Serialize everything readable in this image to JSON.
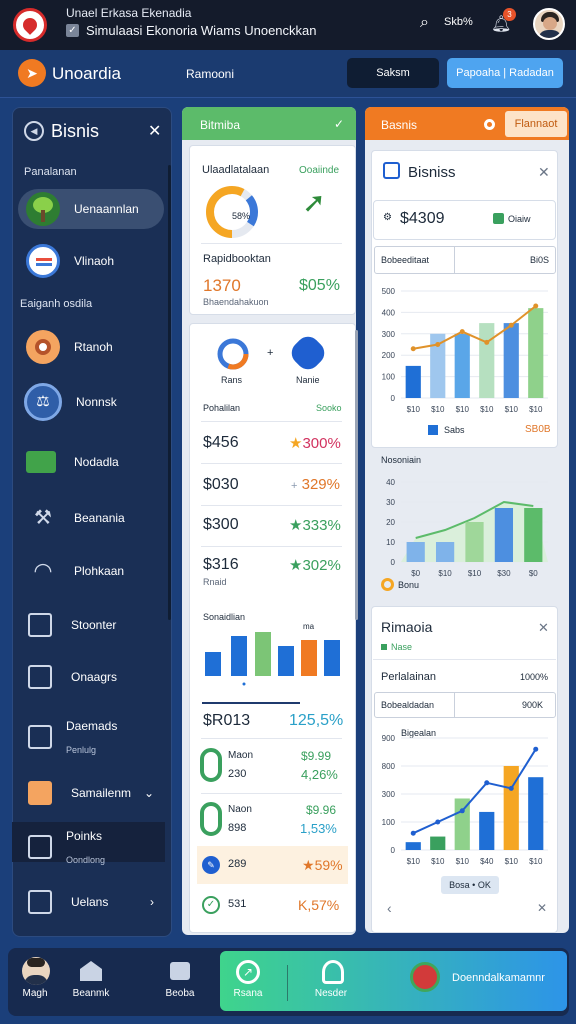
{
  "topbar": {
    "line1": "Unael Erkasa Ekenadia",
    "line2": "Simulaasi Ekonoria Wiams Unoenckkan",
    "search_label": "Skb%",
    "notif_count": "3"
  },
  "nav": {
    "app_name": "Unoardia",
    "middle": "Ramooni",
    "btn_dark": "Saksm",
    "btn_blue": "Papoaha | Radadan"
  },
  "sidebar": {
    "title": "Bisnis",
    "section1": "Panalanan",
    "section2": "Eaiganh osdila",
    "items": [
      {
        "label": "Uenaannlan"
      },
      {
        "label": "Vlinaoh"
      },
      {
        "label": "Rtanoh"
      },
      {
        "label": "Nonnsk"
      },
      {
        "label": "Nodadla"
      },
      {
        "label": "Beanania"
      },
      {
        "label": "Plohkaan"
      },
      {
        "label": "Stoonter"
      },
      {
        "label": "Onaagrs"
      },
      {
        "label": "Daemads",
        "sub": "Penlulg"
      },
      {
        "label": "Samailenm"
      },
      {
        "label": "Poinks",
        "sub": "Oondlong"
      },
      {
        "label": "Uelans"
      }
    ]
  },
  "col1": {
    "header": "Bitmiba",
    "card1": {
      "title": "Ulaadlatalaan",
      "pct_label": "Ooaiinde",
      "donut_label": "58%",
      "row_label": "Rapidbooktan",
      "value": "1370",
      "value_sub": "Bhaendahakuon",
      "pct": "$05%"
    },
    "card2": {
      "icon1_label": "Rans",
      "icon2_label": "Nanie",
      "table_label": "Pohalilan",
      "table_pct_label": "Sooko",
      "rows": [
        {
          "value": "$456",
          "pct": "300%",
          "color": "#d2325f"
        },
        {
          "value": "$030",
          "pct": "329%",
          "color": "#e0772a"
        },
        {
          "value": "$300",
          "pct": "333%",
          "color": "#3aa05e"
        },
        {
          "value": "$316",
          "pct": "302%",
          "color": "#3aa05e",
          "sub": "Rnaid"
        }
      ],
      "chart_label": "Sonaidlian",
      "chart_mark": "ma",
      "summary_value": "$R013",
      "summary_pct": "125,5%",
      "list": [
        {
          "title": "Maon",
          "value": "230",
          "chg1": "$9.99",
          "chg2": "4,26%"
        },
        {
          "title": "Naon",
          "value": "898",
          "chg1": "$9.96",
          "chg2": "1,53%"
        },
        {
          "value": "289",
          "chg": "59%"
        },
        {
          "value": "531",
          "chg": "57%"
        }
      ]
    }
  },
  "col2": {
    "header": "Basnis",
    "header_right": "Flannaot",
    "card1": {
      "title": "Bisniss",
      "value": "$4309",
      "tag": "Oiaiw",
      "field": "Bobeeditaat",
      "field_right": "Bi0S",
      "legend1": "Sabs",
      "legend2": "SB0B"
    },
    "card2": {
      "title": "Nosoniain",
      "legend": "Bonu"
    },
    "card3": {
      "title": "Rimaoia",
      "tag": "Nase",
      "row_label": "Perlalainan",
      "row_value": "1000%",
      "field": "Bobealdadan",
      "field_right": "900K",
      "chart_label": "Bigealan",
      "footer_tag": "Bosa • OK"
    }
  },
  "bottom": {
    "items": [
      {
        "label": "Magh"
      },
      {
        "label": "Beanmk"
      },
      {
        "label": "Beoba"
      },
      {
        "label": "Rsana"
      },
      {
        "label": "Nesder"
      },
      {
        "label": "Doenndalkamamnr"
      }
    ]
  },
  "chart_data": [
    {
      "type": "bar",
      "title": "",
      "categories": [
        "$10",
        "$10",
        "$10",
        "$10",
        "$10",
        "$10"
      ],
      "yticks": [
        0,
        100,
        200,
        300,
        400,
        500
      ],
      "series": [
        {
          "values": [
            150,
            300,
            300,
            350,
            350,
            420
          ]
        }
      ],
      "line_values": [
        230,
        250,
        310,
        260,
        340,
        430
      ],
      "ylim": [
        0,
        500
      ]
    },
    {
      "type": "bar",
      "categories": [
        "$0",
        "$10",
        "$10",
        "$30",
        "$0"
      ],
      "yticks": [
        0,
        10,
        20,
        30,
        40
      ],
      "series": [
        {
          "values": [
            10,
            10,
            20,
            27,
            27
          ]
        }
      ],
      "ylim": [
        0,
        40
      ]
    },
    {
      "type": "bar",
      "categories": [
        "$10",
        "$10",
        "$10",
        "$40",
        "$10",
        "$10"
      ],
      "yticks": [
        0,
        100,
        300,
        800,
        900
      ],
      "series": [
        {
          "values": [
            70,
            120,
            460,
            340,
            750,
            650
          ]
        }
      ],
      "line_values": [
        150,
        250,
        350,
        600,
        550,
        900
      ],
      "ylim": [
        0,
        1000
      ]
    }
  ]
}
